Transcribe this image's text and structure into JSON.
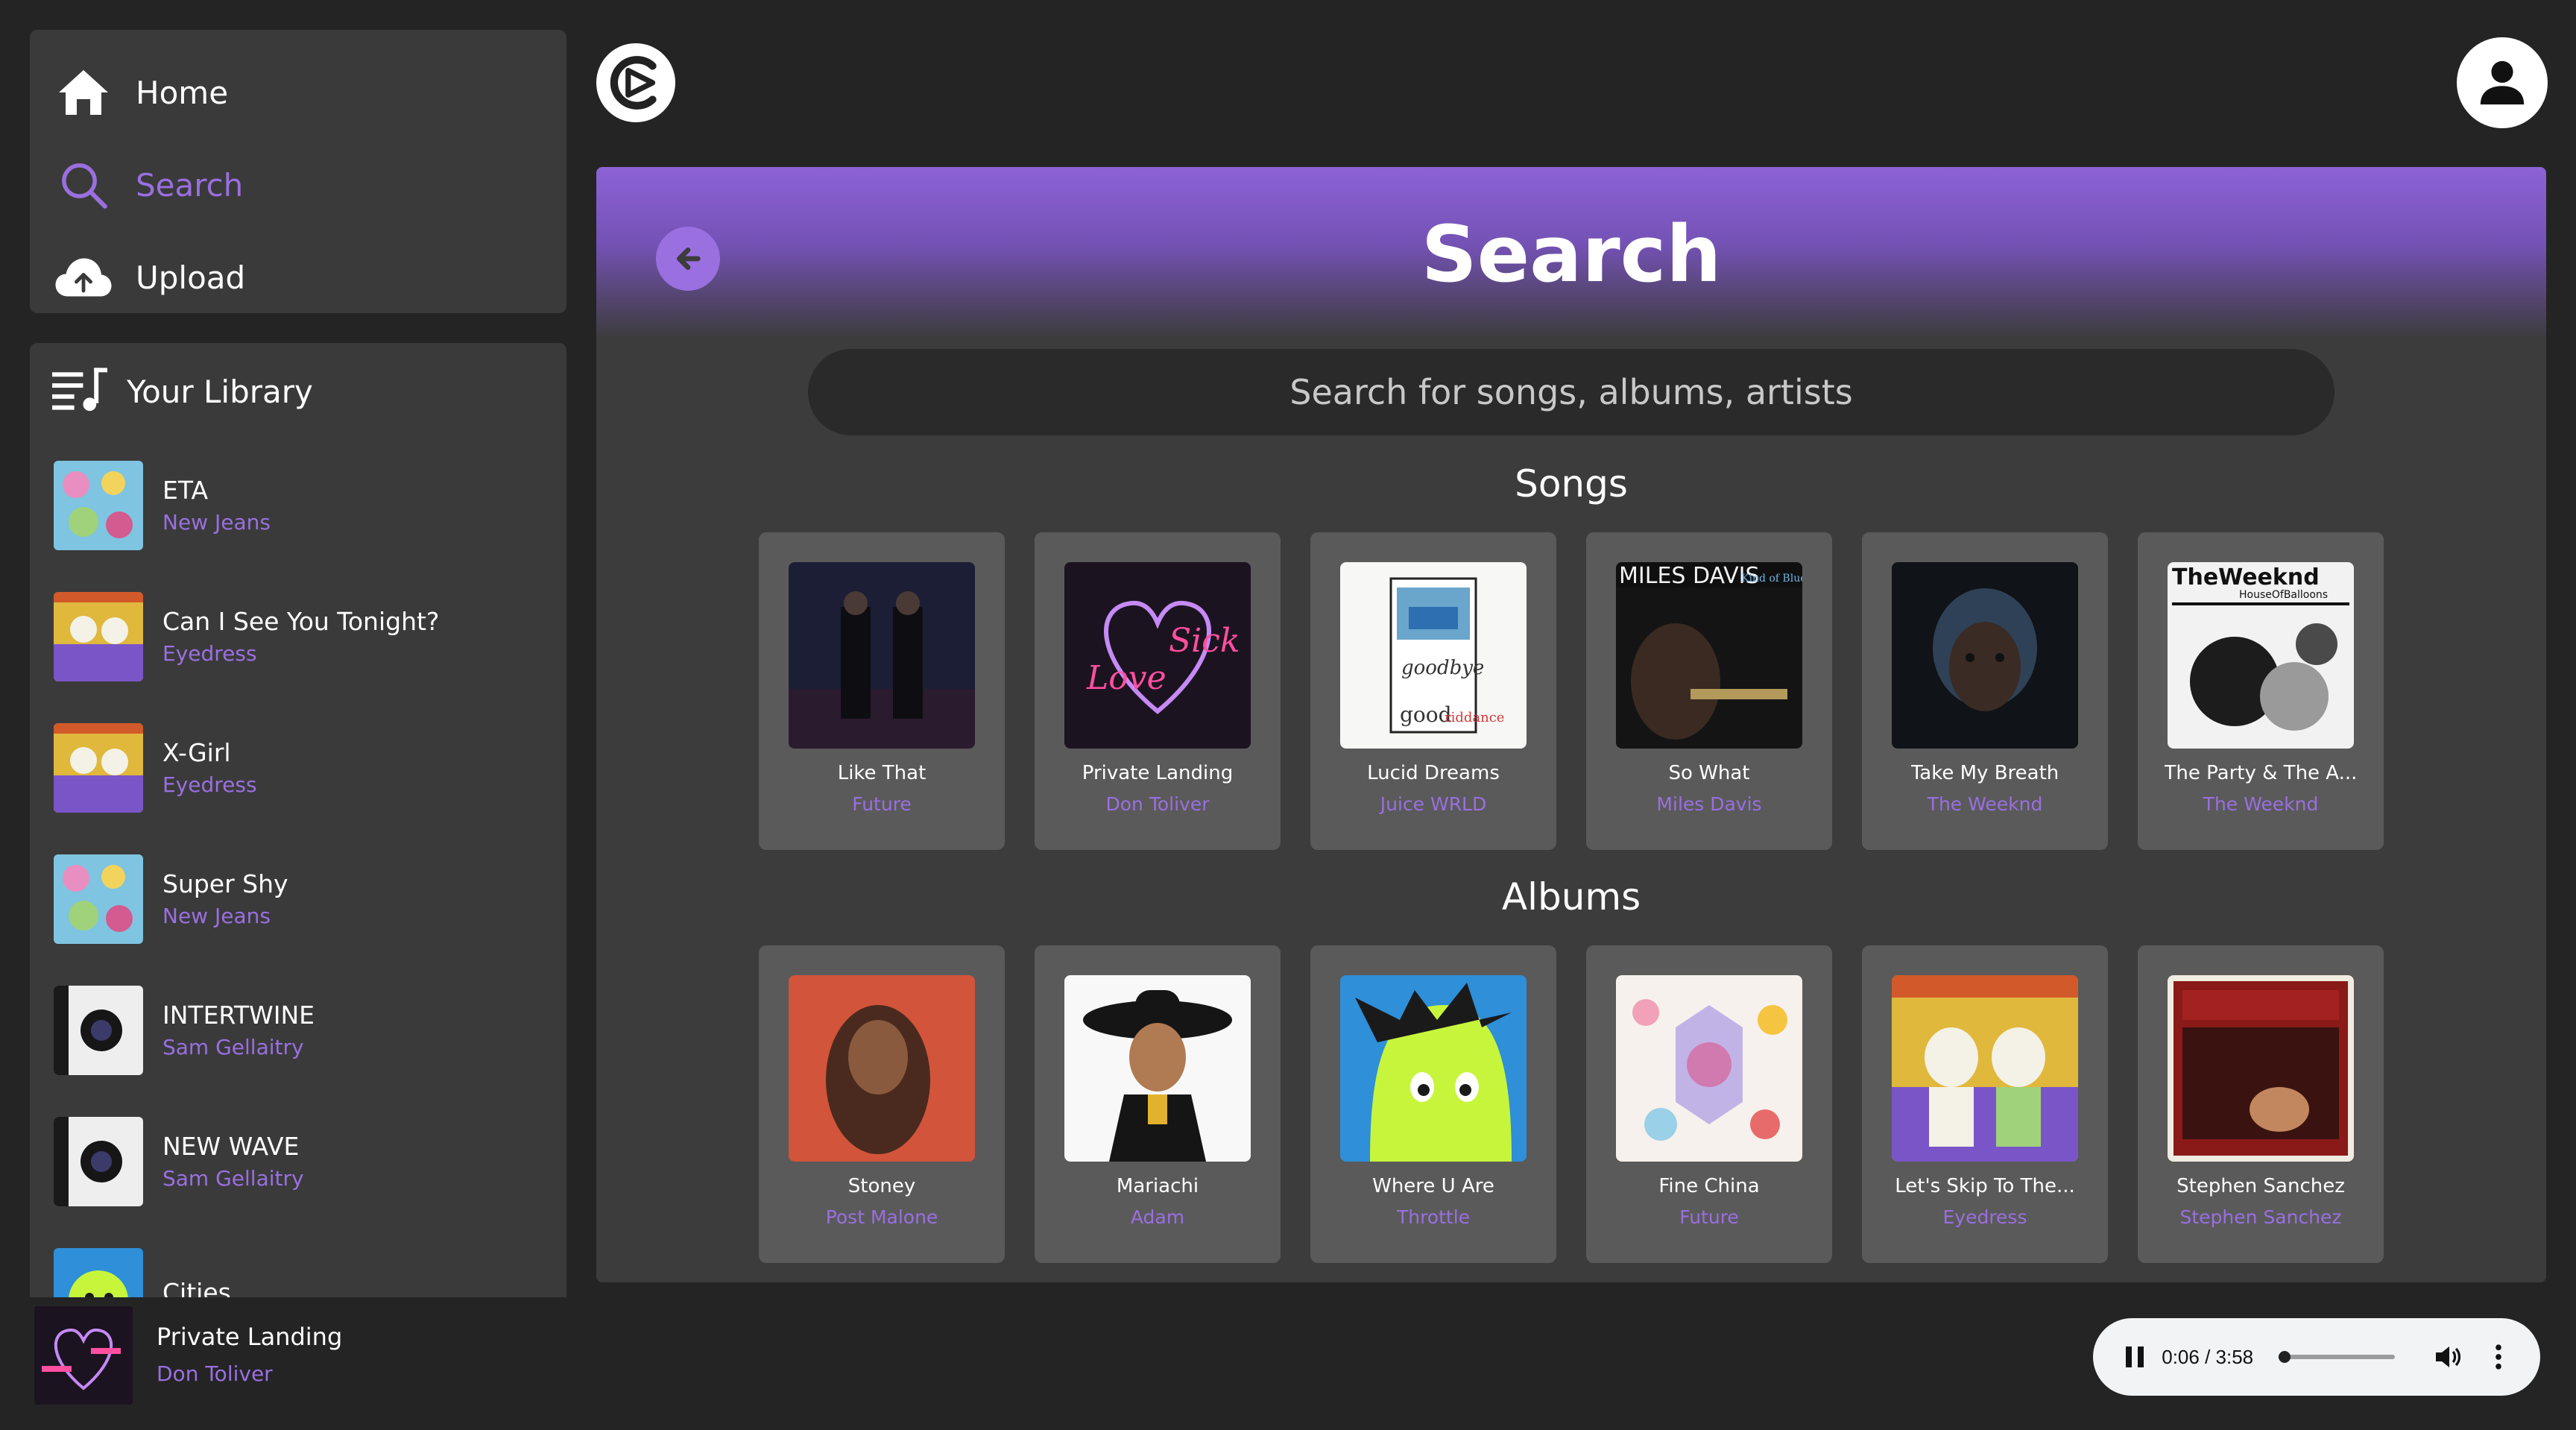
{
  "nav": {
    "items": [
      {
        "label": "Home",
        "icon": "home-icon"
      },
      {
        "label": "Search",
        "icon": "search-icon",
        "active": true
      },
      {
        "label": "Upload",
        "icon": "cloud-upload-icon"
      }
    ]
  },
  "library": {
    "title": "Your Library",
    "items": [
      {
        "title": "ETA",
        "artist": "New Jeans"
      },
      {
        "title": "Can I See You Tonight?",
        "artist": "Eyedress"
      },
      {
        "title": "X-Girl",
        "artist": "Eyedress"
      },
      {
        "title": "Super Shy",
        "artist": "New Jeans"
      },
      {
        "title": "INTERTWINE",
        "artist": "Sam Gellaitry"
      },
      {
        "title": "NEW WAVE",
        "artist": "Sam Gellaitry"
      },
      {
        "title": "Cities",
        "artist": ""
      }
    ]
  },
  "main": {
    "title": "Search",
    "search_placeholder": "Search for songs, albums, artists",
    "songs_title": "Songs",
    "albums_title": "Albums",
    "songs": [
      {
        "title": "Like That",
        "artist": "Future"
      },
      {
        "title": "Private Landing",
        "artist": "Don Toliver"
      },
      {
        "title": "Lucid Dreams",
        "artist": "Juice WRLD"
      },
      {
        "title": "So What",
        "artist": "Miles Davis"
      },
      {
        "title": "Take My Breath",
        "artist": "The Weeknd"
      },
      {
        "title": "The Party & The A...",
        "artist": "The Weeknd"
      }
    ],
    "albums": [
      {
        "title": "Stoney",
        "artist": "Post Malone"
      },
      {
        "title": "Mariachi",
        "artist": "Adam"
      },
      {
        "title": "Where U Are",
        "artist": "Throttle"
      },
      {
        "title": "Fine China",
        "artist": "Future"
      },
      {
        "title": "Let's Skip To The...",
        "artist": "Eyedress"
      },
      {
        "title": "Stephen Sanchez",
        "artist": "Stephen Sanchez"
      }
    ]
  },
  "now_playing": {
    "title": "Private Landing",
    "artist": "Don Toliver"
  },
  "player": {
    "time": "0:06 / 3:58",
    "progress": 0.025
  },
  "colors": {
    "accent": "#9a6fe0",
    "background": "#242424",
    "panel": "#3a3a3a",
    "card": "#5a5a5a"
  }
}
